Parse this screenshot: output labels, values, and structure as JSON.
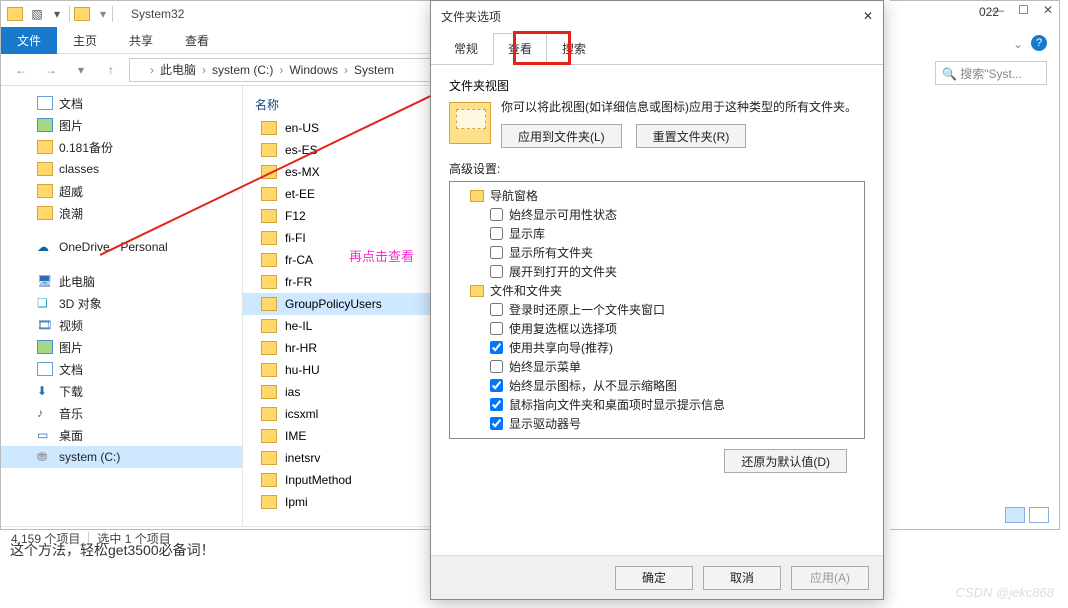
{
  "explorer": {
    "title": "System32",
    "tabs": {
      "file": "文件",
      "home": "主页",
      "share": "共享",
      "view": "查看"
    },
    "breadcrumb": [
      "此电脑",
      "system (C:)",
      "Windows",
      "System"
    ],
    "nav": [
      {
        "label": "文档",
        "ico": "ico-doc"
      },
      {
        "label": "图片",
        "ico": "ico-pic"
      },
      {
        "label": "0.181备份",
        "ico": "ico-folder"
      },
      {
        "label": "classes",
        "ico": "ico-folder"
      },
      {
        "label": "超威",
        "ico": "ico-folder"
      },
      {
        "label": "浪潮",
        "ico": "ico-folder"
      },
      {
        "label": "",
        "blank": true
      },
      {
        "label": "OneDrive - Personal",
        "ico": "ico-onedrive"
      },
      {
        "label": "",
        "blank": true
      },
      {
        "label": "此电脑",
        "ico": "ico-pc"
      },
      {
        "label": "3D 对象",
        "ico": "ico-3d"
      },
      {
        "label": "视频",
        "ico": "ico-video"
      },
      {
        "label": "图片",
        "ico": "ico-pic"
      },
      {
        "label": "文档",
        "ico": "ico-doc"
      },
      {
        "label": "下载",
        "ico": "ico-dl"
      },
      {
        "label": "音乐",
        "ico": "ico-music"
      },
      {
        "label": "桌面",
        "ico": "ico-desktop"
      },
      {
        "label": "system (C:)",
        "ico": "ico-disk",
        "sel": true
      }
    ],
    "listHeader": "名称",
    "items": [
      "en-US",
      "es-ES",
      "es-MX",
      "et-EE",
      "F12",
      "fi-FI",
      "fr-CA",
      "fr-FR",
      "GroupPolicyUsers",
      "he-IL",
      "hr-HR",
      "hu-HU",
      "ias",
      "icsxml",
      "IME",
      "inetsrv",
      "InputMethod",
      "Ipmi"
    ],
    "selected": "GroupPolicyUsers",
    "status": {
      "count": "4,159 个项目",
      "sel": "选中 1 个项目"
    }
  },
  "explorer2": {
    "year": "022",
    "search": "搜索\"Syst..."
  },
  "dialog": {
    "title": "文件夹选项",
    "tabs": {
      "general": "常规",
      "view": "查看",
      "search": "搜索"
    },
    "folderView": {
      "heading": "文件夹视图",
      "text": "你可以将此视图(如详细信息或图标)应用于这种类型的所有文件夹。",
      "apply": "应用到文件夹(L)",
      "reset": "重置文件夹(R)"
    },
    "advancedLabel": "高级设置:",
    "tree": {
      "navpane": "导航窗格",
      "nav_items": [
        {
          "label": "始终显示可用性状态",
          "chk": false
        },
        {
          "label": "显示库",
          "chk": false
        },
        {
          "label": "显示所有文件夹",
          "chk": false
        },
        {
          "label": "展开到打开的文件夹",
          "chk": false
        }
      ],
      "filesfolders": "文件和文件夹",
      "ff_items": [
        {
          "label": "登录时还原上一个文件夹窗口",
          "chk": false
        },
        {
          "label": "使用复选框以选择项",
          "chk": false
        },
        {
          "label": "使用共享向导(推荐)",
          "chk": true
        },
        {
          "label": "始终显示菜单",
          "chk": false
        },
        {
          "label": "始终显示图标，从不显示缩略图",
          "chk": true
        },
        {
          "label": "鼠标指向文件夹和桌面项时显示提示信息",
          "chk": true
        },
        {
          "label": "显示驱动器号",
          "chk": true
        }
      ]
    },
    "restore": "还原为默认值(D)",
    "footer": {
      "ok": "确定",
      "cancel": "取消",
      "apply": "应用(A)"
    }
  },
  "annotation": "再点击查看",
  "bottom": "这个方法，轻松get3500必备词！",
  "watermark": "CSDN @jekc868"
}
